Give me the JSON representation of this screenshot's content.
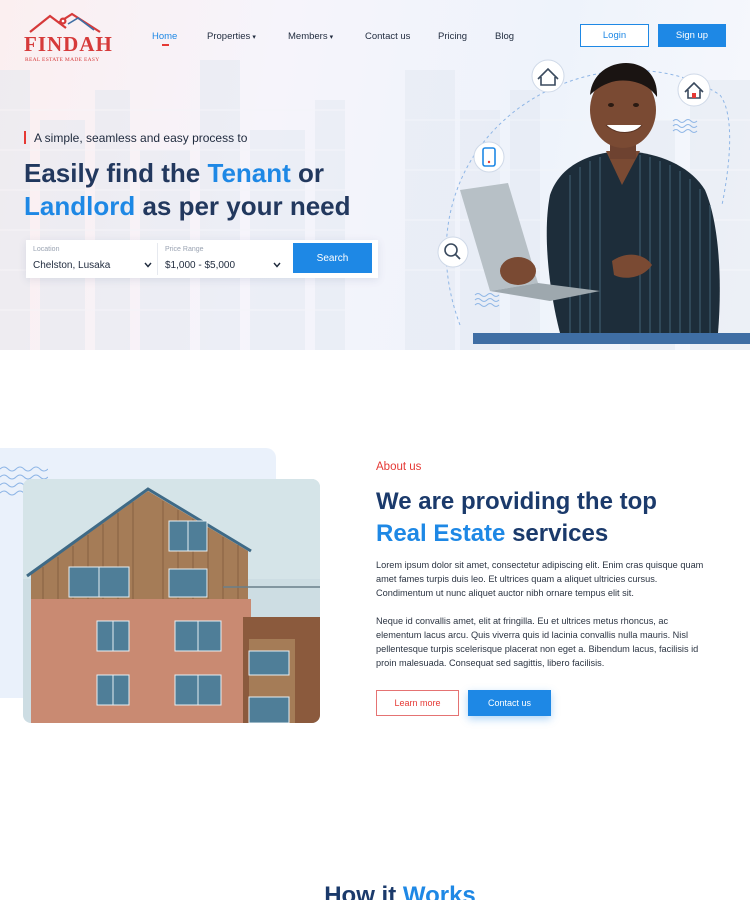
{
  "logo": {
    "word": "FINDAH",
    "tagline": "REAL ESTATE MADE EASY"
  },
  "nav": {
    "items": [
      {
        "label": "Home",
        "active": true
      },
      {
        "label": "Properties",
        "has_caret": true
      },
      {
        "label": "Members",
        "has_caret": true
      },
      {
        "label": "Contact us"
      },
      {
        "label": "Pricing"
      },
      {
        "label": "Blog"
      }
    ],
    "caret": "▾",
    "login_label": "Login",
    "signup_label": "Sign up"
  },
  "hero": {
    "tagline": "A simple, seamless and easy process to",
    "title_part1": "Easily find the ",
    "title_highlight1": "Tenant",
    "title_part2": " or",
    "title_highlight2": "Landlord",
    "title_part3": " as per your need",
    "search": {
      "location_label": "Location",
      "location_value": "Chelston, Lusaka",
      "price_label": "Price Range",
      "price_value": "$1,000 - $5,000",
      "button_label": "Search"
    },
    "icons": [
      "house-price-icon",
      "home-icon",
      "phone-icon",
      "search-house-icon"
    ]
  },
  "about": {
    "kicker": "About us",
    "title_line1": "We are providing the top",
    "title_highlight": "Real Estate",
    "title_rest": " services",
    "paragraph1": "Lorem ipsum dolor sit amet, consectetur adipiscing elit. Enim cras quisque quam amet fames turpis duis leo. Et ultrices quam a aliquet ultricies cursus. Condimentum ut nunc aliquet auctor nibh ornare tempus elit sit.",
    "paragraph2": "Neque id convallis amet, elit at fringilla. Eu et ultrices metus rhoncus, ac elementum lacus arcu. Quis viverra quis id lacinia convallis nulla mauris. Nisl pellentesque turpis scelerisque placerat non eget a. Bibendum lacus, facilisis id proin malesuada. Consequat sed sagittis, libero facilisis.",
    "learn_more_label": "Learn more",
    "contact_label": "Contact us"
  },
  "how": {
    "title_part1": "How it ",
    "title_highlight": "Works"
  },
  "colors": {
    "brand_red": "#d63a3a",
    "accent_blue": "#1e88e5",
    "navy": "#1b3a6b"
  }
}
